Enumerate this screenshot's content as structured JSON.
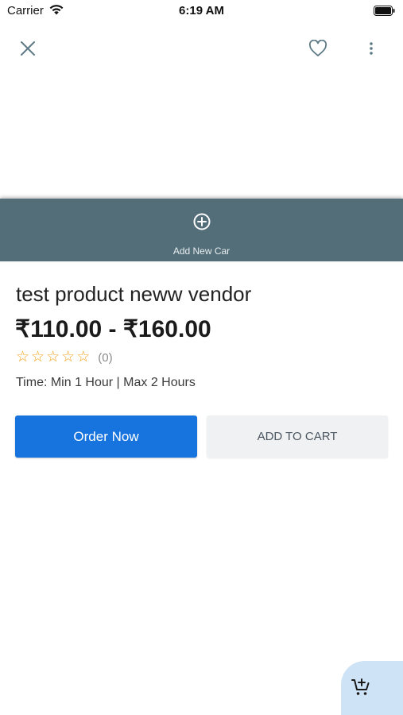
{
  "status_bar": {
    "carrier": "Carrier",
    "time": "6:19 AM",
    "wifi_icon": "wifi-icon",
    "battery_icon": "battery-icon"
  },
  "nav": {
    "close_icon": "close-icon",
    "favorite_icon": "heart-icon",
    "more_icon": "more-vertical-icon"
  },
  "add_car": {
    "label": "Add New Car",
    "icon": "plus-circle-icon",
    "band_color": "#546e79"
  },
  "product": {
    "title": "test product neww vendor",
    "price": "₹110.00 - ₹160.00",
    "rating": 0,
    "rating_max": 5,
    "rating_count": "(0)",
    "time": "Time: Min 1 Hour | Max 2 Hours"
  },
  "actions": {
    "order_now": "Order Now",
    "add_to_cart": "ADD TO CART",
    "primary_color": "#1773dd"
  },
  "floating_cart": {
    "icon": "cart-add-icon",
    "color": "#cfe3f7"
  }
}
